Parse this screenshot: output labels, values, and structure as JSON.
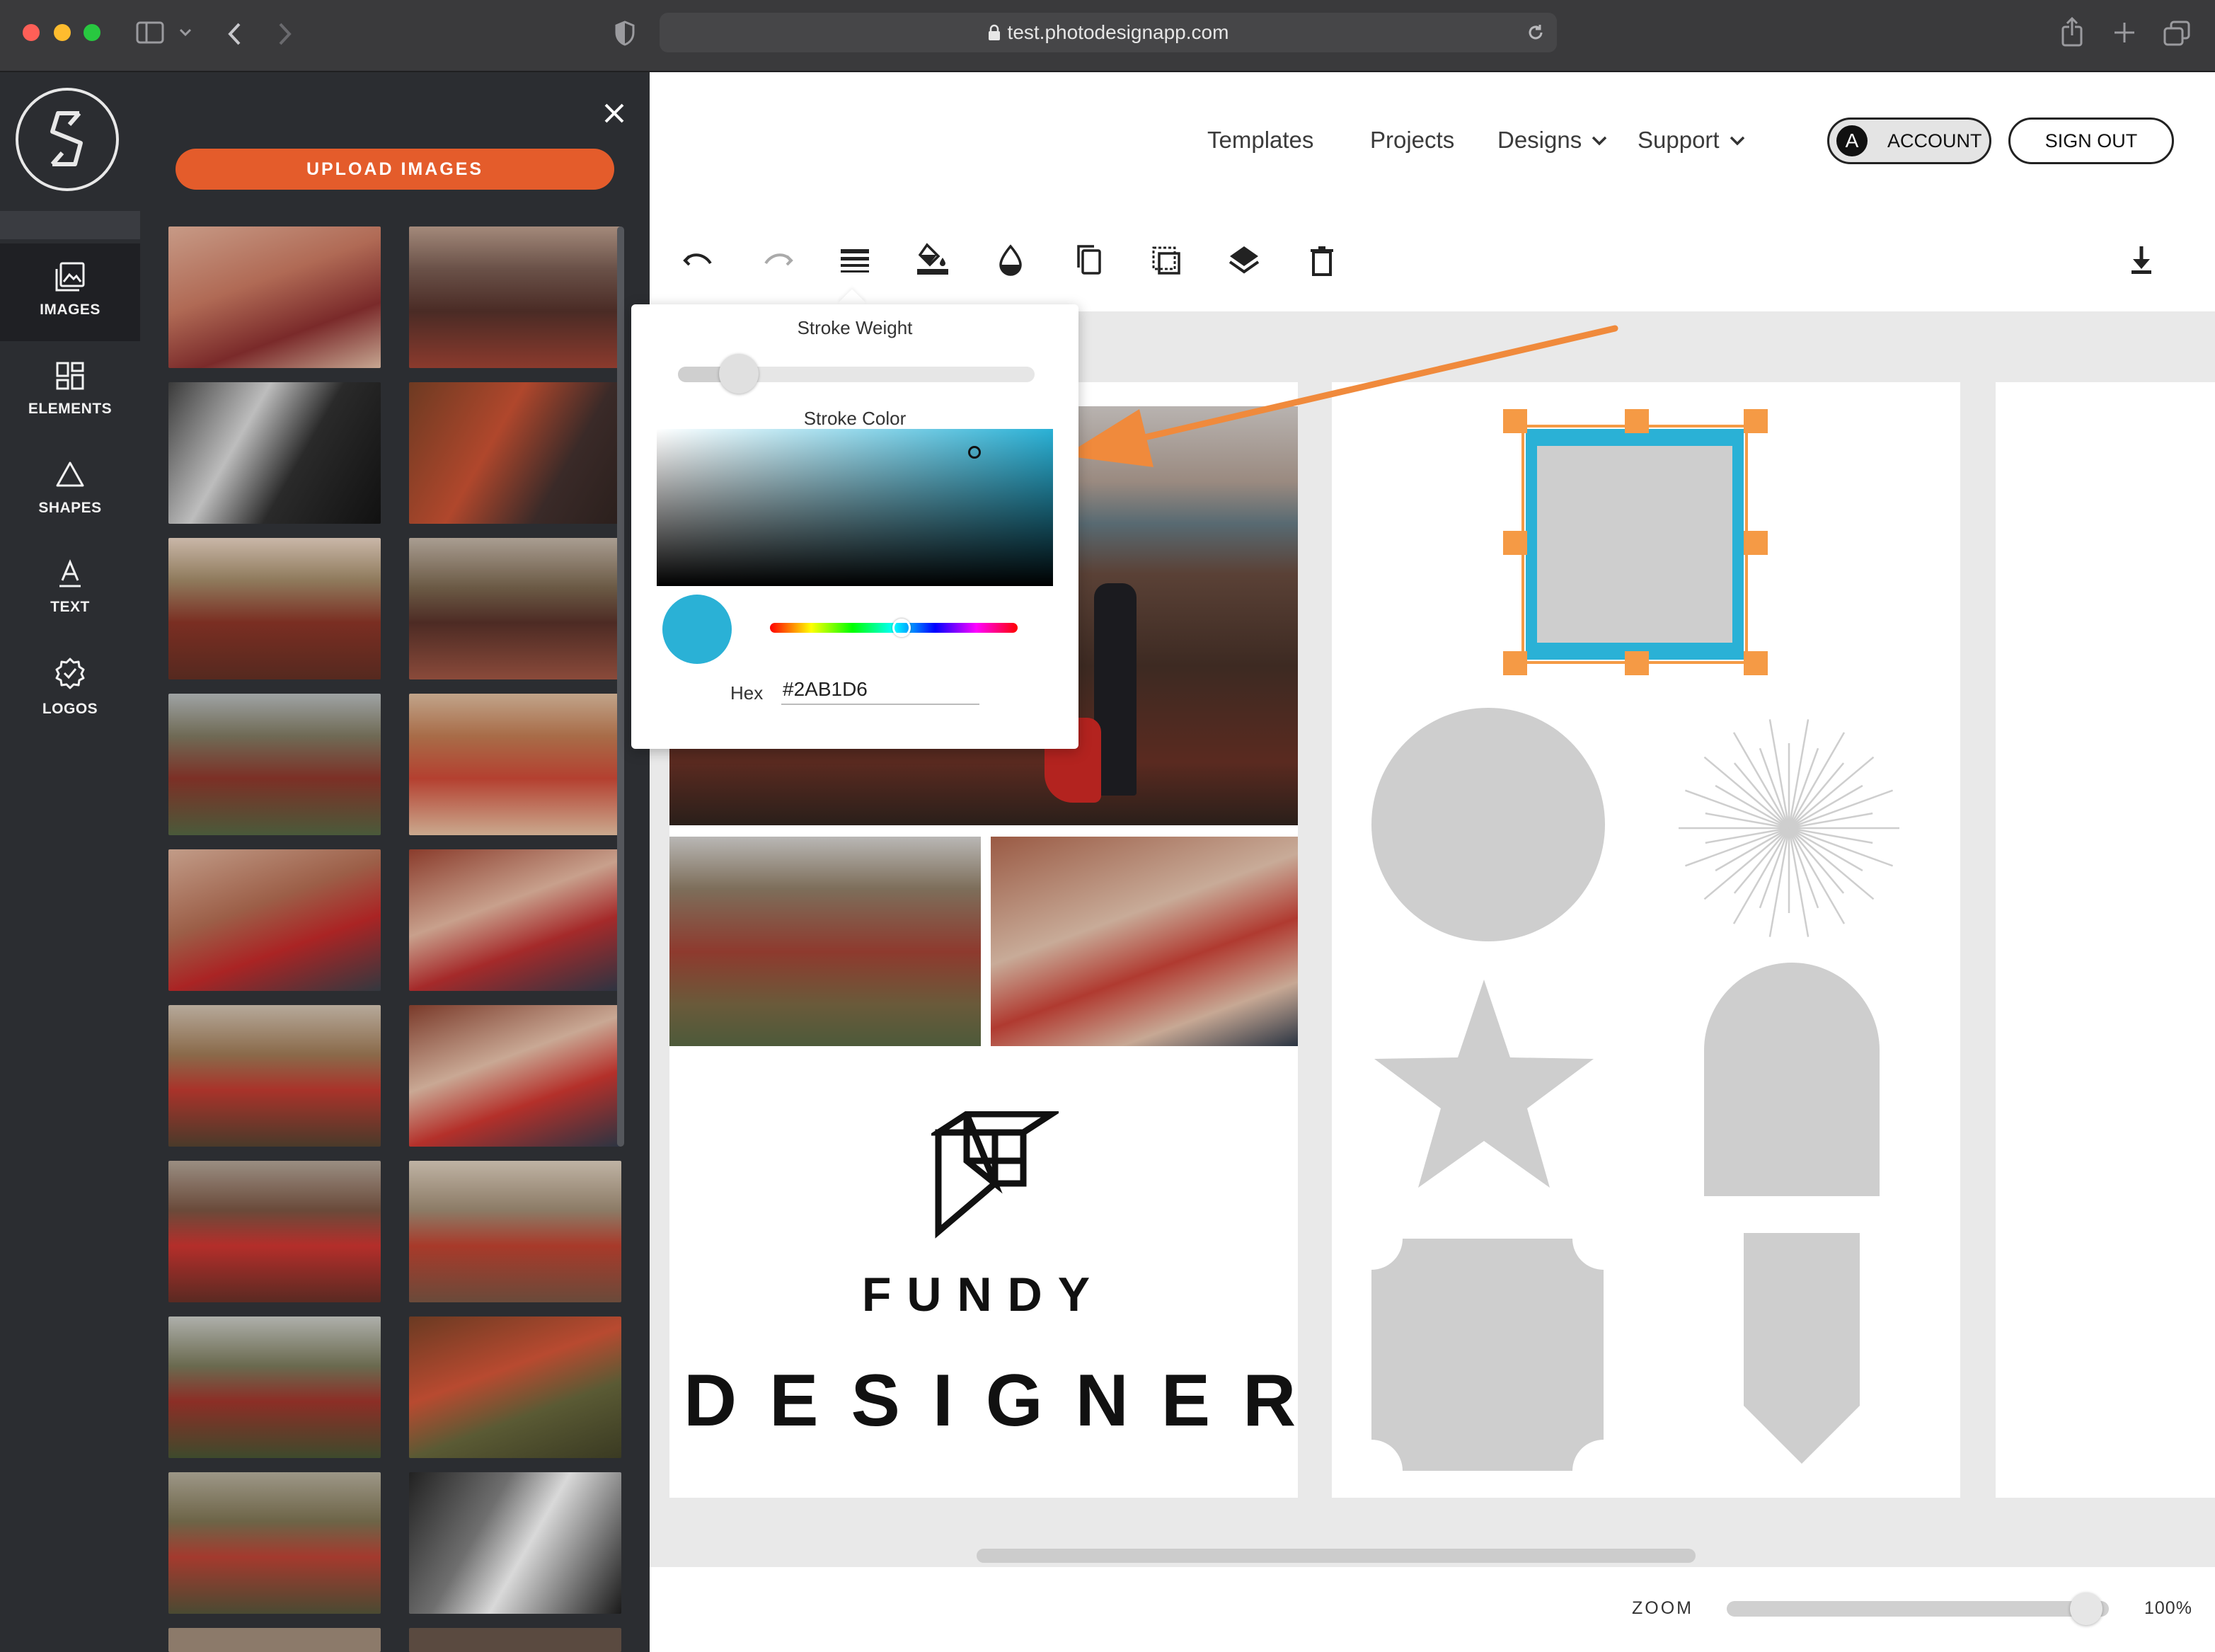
{
  "browser": {
    "url": "test.photodesignapp.com"
  },
  "sidebar": {
    "items": [
      {
        "label": "IMAGES",
        "icon": "image-icon",
        "active": true
      },
      {
        "label": "ELEMENTS",
        "icon": "elements-grid-icon",
        "active": false
      },
      {
        "label": "SHAPES",
        "icon": "triangle-icon",
        "active": false
      },
      {
        "label": "TEXT",
        "icon": "text-a-icon",
        "active": false
      },
      {
        "label": "LOGOS",
        "icon": "badge-check-icon",
        "active": false
      }
    ]
  },
  "image_panel": {
    "upload_label": "UPLOAD IMAGES"
  },
  "nav": {
    "templates": "Templates",
    "projects": "Projects",
    "designs": "Designs",
    "support": "Support",
    "account_initial": "A",
    "account_label": "ACCOUNT",
    "sign_out": "SIGN OUT"
  },
  "toolbar": {
    "tools": [
      "undo-icon",
      "redo-icon",
      "stroke-weight-icon",
      "fill-color-icon",
      "opacity-drop-icon",
      "duplicate-icon",
      "bring-forward-icon",
      "layers-icon",
      "delete-icon",
      "download-icon"
    ]
  },
  "stroke_popover": {
    "weight_label": "Stroke Weight",
    "weight_value": 0.17,
    "color_label": "Stroke Color",
    "hex_label": "Hex",
    "hex_value": "#2AB1D6",
    "hue_position": 0.53
  },
  "canvas": {
    "logo_line1": "FUNDY",
    "logo_line2": "DESIGNER"
  },
  "zoom": {
    "label": "ZOOM",
    "value_label": "100%",
    "level": 0.94
  },
  "colors": {
    "accent": "#e45c2b",
    "stroke": "#2ab1d6",
    "selection": "#f59a45",
    "arrow": "#f08a3c",
    "shape_gray": "#cecece"
  }
}
